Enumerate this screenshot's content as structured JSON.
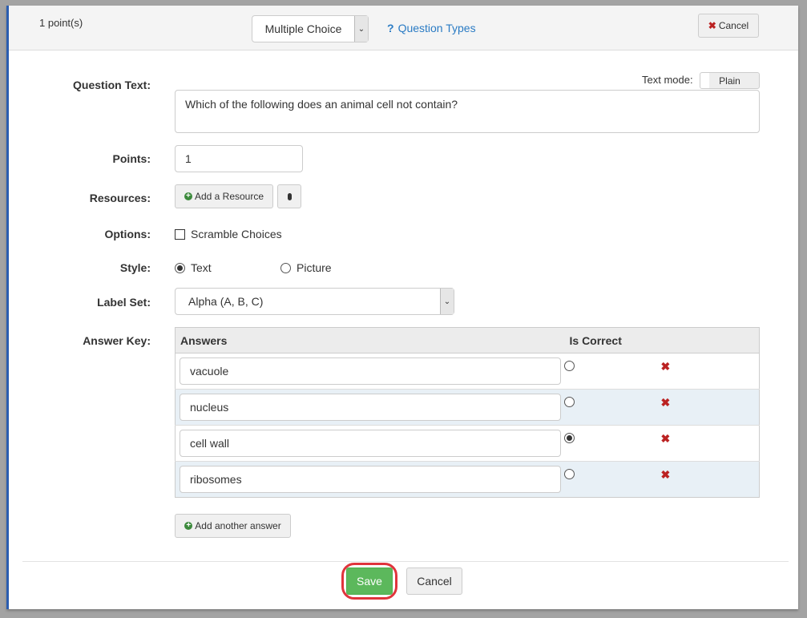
{
  "header": {
    "points": "1 point(s)",
    "question_type": "Multiple Choice",
    "question_types_link": "Question Types",
    "cancel": "Cancel"
  },
  "form": {
    "question_text_label": "Question Text:",
    "text_mode_label": "Text mode:",
    "text_mode_value": "Plain",
    "question_text": "Which of the following does an animal cell not contain?",
    "points_label": "Points:",
    "points_value": "1",
    "resources_label": "Resources:",
    "add_resource": "Add a Resource",
    "options_label": "Options:",
    "scramble": "Scramble Choices",
    "scramble_checked": false,
    "style_label": "Style:",
    "style_text": "Text",
    "style_picture": "Picture",
    "style_selected": "Text",
    "label_set_label": "Label Set:",
    "label_set_value": "Alpha (A, B, C)",
    "answer_key_label": "Answer Key:",
    "answers_header": "Answers",
    "is_correct_header": "Is Correct",
    "answers": [
      {
        "text": "vacuole",
        "correct": false
      },
      {
        "text": "nucleus",
        "correct": false
      },
      {
        "text": "cell wall",
        "correct": true
      },
      {
        "text": "ribosomes",
        "correct": false
      }
    ],
    "add_answer": "Add another answer"
  },
  "footer": {
    "save": "Save",
    "cancel": "Cancel"
  },
  "colors": {
    "accent": "#2a5db0",
    "save": "#5cb85c",
    "highlight": "#e0343c",
    "link": "#2a7bc4"
  }
}
